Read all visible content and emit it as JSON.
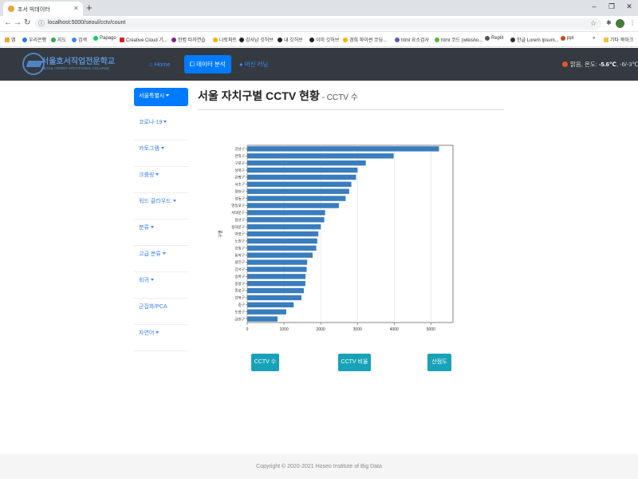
{
  "browser": {
    "tab_title": "조서 빅데이터",
    "url": "localhost:5000/seoul/cctv/count",
    "profile_label": "작품",
    "bookmarks": [
      "앱",
      "우리은행",
      "지도",
      "검색",
      "Papago",
      "Creative Cloud 기...",
      "한컴 타자연습",
      "나토파트",
      "강사남 깃허브",
      "내 깃허브",
      "이미 깃허브",
      "경희 파이썬 코딩...",
      "html 요소검사",
      "html 코드 (wikisho...",
      "Replit",
      "한글 Lorem Ipsum...",
      "ppt",
      "기타 북마크"
    ]
  },
  "navbar": {
    "brand_name": "서울호서직업전문학교",
    "brand_sub": "SEOUL HOSEO VOCATIONAL COLLEGE",
    "items": [
      {
        "label": "Home",
        "icon": "home-icon"
      },
      {
        "label": "데이터 분석",
        "icon": "chart-icon"
      },
      {
        "label": "머신 러닝",
        "icon": "globe-icon"
      }
    ],
    "weather_prefix": "맑음, 온도:",
    "weather_temp": "-5.6℃",
    "weather_range": ", -6/-3℃"
  },
  "sidebar": {
    "items": [
      "서울특별시",
      "코로나-19",
      "카토그램",
      "크롤링",
      "워드 클라우드",
      "분류",
      "고급 분류",
      "회귀",
      "군집화/PCA",
      "자연어"
    ],
    "caret_items": [
      true,
      true,
      true,
      true,
      true,
      true,
      true,
      true,
      false,
      true
    ]
  },
  "main": {
    "title": "서울 자치구별 CCTV 현황",
    "subtitle": " - CCTV 수"
  },
  "chart_data": {
    "type": "bar",
    "orientation": "horizontal",
    "ylabel": "구별",
    "categories": [
      "강남구",
      "관악구",
      "구로구",
      "성북구",
      "은평구",
      "서초구",
      "양천구",
      "성동구",
      "영등포구",
      "서대문구",
      "용산구",
      "동대문구",
      "마포구",
      "노원구",
      "강동구",
      "동작구",
      "광진구",
      "강서구",
      "송파구",
      "중랑구",
      "종로구",
      "강북구",
      "중구",
      "도봉구",
      "금천구"
    ],
    "values": [
      5221,
      3985,
      3227,
      3003,
      2962,
      2834,
      2775,
      2679,
      2495,
      2121,
      2096,
      2003,
      1935,
      1906,
      1879,
      1780,
      1632,
      1617,
      1586,
      1582,
      1540,
      1475,
      1265,
      1063,
      825
    ],
    "xlim": [
      0,
      5600
    ],
    "xticks": [
      0,
      1000,
      2000,
      3000,
      4000,
      5000
    ],
    "grid": true,
    "bar_color": "#3a7dbd"
  },
  "buttons": [
    "CCTV 수",
    "CCTV 비율",
    "산점도"
  ],
  "footer": "Copyright © 2020-2021 Hoseo Institute of Big Data"
}
